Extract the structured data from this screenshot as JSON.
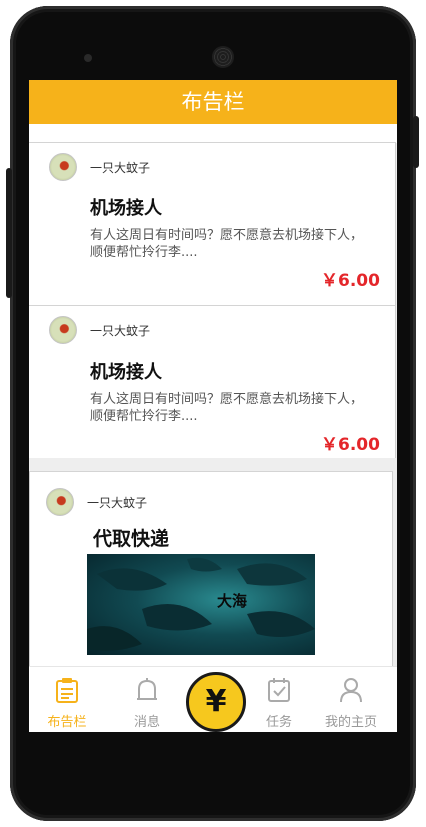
{
  "header": {
    "title": "布告栏"
  },
  "posts": [
    {
      "author": "一只大蚊子",
      "title": "机场接人",
      "description": "有人这周日有时间吗？愿不愿意去机场接下人，顺便帮忙拎行李....",
      "price": "￥6.00"
    },
    {
      "author": "一只大蚊子",
      "title": "机场接人",
      "description": "有人这周日有时间吗？愿不愿意去机场接下人，顺便帮忙拎行李....",
      "price": "￥6.00"
    },
    {
      "author": "一只大蚊子",
      "title": "代取快递",
      "image_text": "大海"
    }
  ],
  "nav": {
    "items": [
      {
        "label": "布告栏",
        "icon": "clipboard-icon",
        "active": true
      },
      {
        "label": "消息",
        "icon": "bell-icon"
      },
      {
        "label": "任务",
        "icon": "task-check-icon"
      },
      {
        "label": "我的主页",
        "icon": "user-icon"
      }
    ],
    "center_symbol": "¥"
  },
  "colors": {
    "accent": "#f6b21a",
    "price": "#e4262a"
  }
}
